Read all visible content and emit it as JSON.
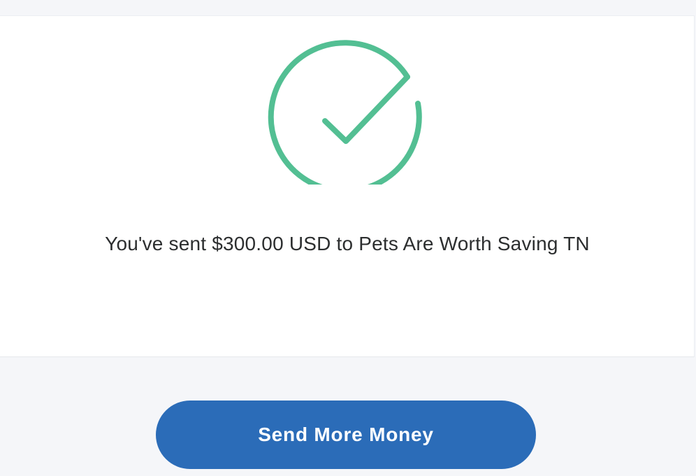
{
  "confirmation": {
    "icon": "check-circle-icon",
    "accent_color": "#53bf93",
    "message": "You've sent $300.00 USD to Pets Are Worth Saving TN"
  },
  "actions": {
    "send_more_label": "Send More Money",
    "button_color": "#2b6cb8"
  }
}
